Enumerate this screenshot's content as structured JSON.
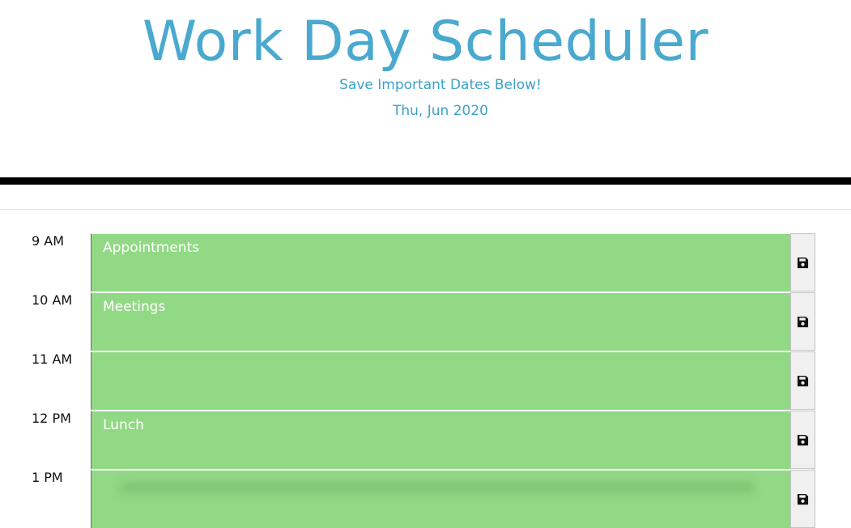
{
  "header": {
    "title": "Work Day Scheduler",
    "subtitle": "Save Important Dates Below!",
    "current_date": "Thu, Jun 2020"
  },
  "colors": {
    "title": "#4aa9cf",
    "future_block": "#91d985",
    "save_button": "#f0f0f0"
  },
  "timeblocks": [
    {
      "hour": "9 AM",
      "text": "Appointments",
      "save_icon": "floppy-disk-icon"
    },
    {
      "hour": "10 AM",
      "text": "Meetings",
      "save_icon": "floppy-disk-icon"
    },
    {
      "hour": "11 AM",
      "text": "",
      "save_icon": "floppy-disk-icon"
    },
    {
      "hour": "12 PM",
      "text": "Lunch",
      "save_icon": "floppy-disk-icon"
    },
    {
      "hour": "1 PM",
      "text": "",
      "save_icon": "floppy-disk-icon"
    }
  ]
}
